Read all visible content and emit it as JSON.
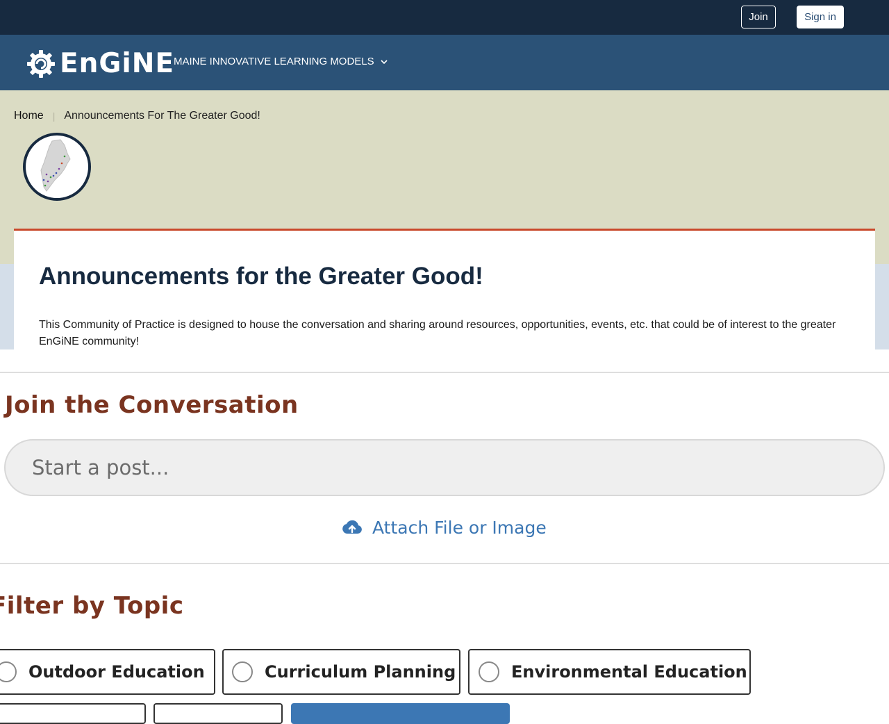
{
  "topbar": {
    "join_label": "Join",
    "signin_label": "Sign in"
  },
  "navbar": {
    "logo_text": "EnGiNE",
    "menu_label": "MAINE INNOVATIVE LEARNING MODELS"
  },
  "breadcrumb": {
    "home": "Home",
    "current": "Announcements For The Greater Good!"
  },
  "community": {
    "title": "Announcements for the Greater Good!",
    "description": "This Community of Practice is designed to house the conversation and sharing around resources, opportunities, events, etc. that could be of interest to the greater EnGiNE community!"
  },
  "conversation": {
    "heading": "Join the Conversation",
    "post_placeholder": "Start a post...",
    "attach_label": "Attach File or Image"
  },
  "filter": {
    "heading": "Filter by Topic",
    "topics": [
      {
        "label": "Outdoor Education"
      },
      {
        "label": "Curriculum Planning"
      },
      {
        "label": "Environmental Education"
      }
    ]
  },
  "colors": {
    "topbar": "#172a40",
    "navbar": "#2b5277",
    "hero": "#dbdcc4",
    "accent_line": "#c9482a",
    "heading_brown": "#7a3420",
    "link_blue": "#3c77b4"
  }
}
